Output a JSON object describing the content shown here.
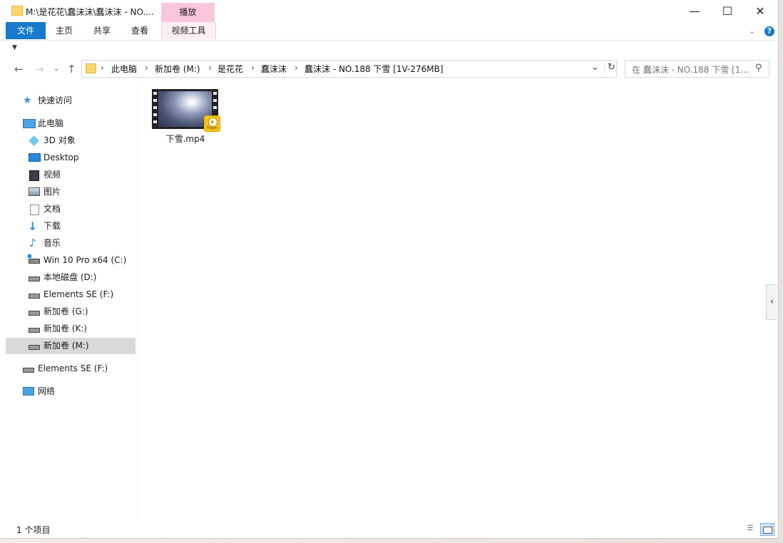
{
  "window": {
    "title": "M:\\是花花\\蠢沫沫\\蠢沫沫 - NO....",
    "contextual_tab_group": "播放",
    "controls": {
      "minimize": "—",
      "maximize": "☐",
      "close": "✕"
    }
  },
  "ribbon": {
    "tabs": [
      "文件",
      "主页",
      "共享",
      "查看",
      "视频工具"
    ],
    "help": "?"
  },
  "address_bar": {
    "breadcrumbs": [
      "此电脑",
      "新加卷 (M:)",
      "是花花",
      "蠢沫沫",
      "蠢沫沫 - NO.188 下雪 [1V-276MB]"
    ],
    "search_placeholder": "在 蠢沫沫 - NO.188 下雪 [1..."
  },
  "nav_pane": {
    "quick_access": "快速访问",
    "this_pc": "此电脑",
    "pc_items": [
      {
        "label": "3D 对象",
        "icon": "cube-3d-icon"
      },
      {
        "label": "Desktop",
        "icon": "desktop-icon"
      },
      {
        "label": "视频",
        "icon": "video-folder-icon"
      },
      {
        "label": "图片",
        "icon": "pictures-folder-icon"
      },
      {
        "label": "文档",
        "icon": "documents-folder-icon"
      },
      {
        "label": "下载",
        "icon": "download-arrow-icon"
      },
      {
        "label": "音乐",
        "icon": "music-note-icon"
      },
      {
        "label": "Win 10 Pro x64 (C:)",
        "icon": "windows-drive-icon"
      },
      {
        "label": "本地磁盘 (D:)",
        "icon": "drive-icon"
      },
      {
        "label": "Elements SE (F:)",
        "icon": "drive-icon"
      },
      {
        "label": "新加卷 (G:)",
        "icon": "drive-icon"
      },
      {
        "label": "新加卷 (K:)",
        "icon": "drive-icon"
      },
      {
        "label": "新加卷 (M:)",
        "icon": "drive-icon",
        "selected": true
      }
    ],
    "external": "Elements SE (F:)",
    "network": "网络"
  },
  "content": {
    "files": [
      {
        "name": "下雪.mp4",
        "icon": "video-thumbnail-icon",
        "badge_text": "Player"
      }
    ]
  },
  "status_bar": {
    "count_text": "1 个项目"
  },
  "colors": {
    "file_tab": "#1979ca",
    "context_tab": "#f9c6dc",
    "selected_item": "#d9d9d9"
  }
}
